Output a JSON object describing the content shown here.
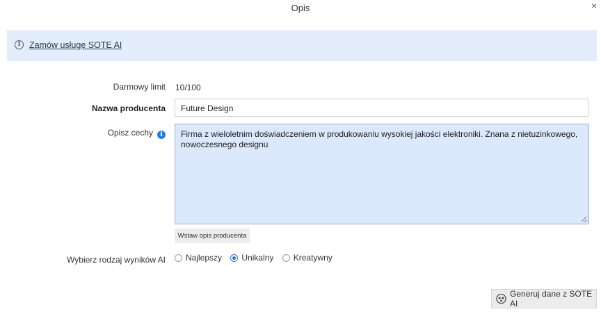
{
  "dialog": {
    "title": "Opis",
    "close_glyph": "×"
  },
  "banner": {
    "icon": "info-icon",
    "link_text": "Zamów usługę SOTE AI"
  },
  "form": {
    "free_limit_label": "Darmowy limit",
    "free_limit_value": "10/100",
    "producer_label": "Nazwa producenta",
    "producer_value": "Future Design",
    "describe_label": "Opisz cechy",
    "describe_value": "Firma z wieloletnim doświadczeniem w produkowaniu wysokiej jakości elektroniki. Znana z nietuzinkowego, nowoczesnego designu",
    "insert_button": "Wstaw opis producenta",
    "result_type_label": "Wybierz rodzaj wyników AI",
    "options": [
      "Najlepszy",
      "Unikalny",
      "Kreatywny"
    ],
    "selected_option": "Unikalny"
  },
  "footer": {
    "generate_button": "Generuj dane z SOTE AI",
    "generate_icon": "ai-sparkle-icon"
  },
  "colors": {
    "banner_bg": "#e4edfb",
    "textarea_bg": "#dce8fb",
    "accent": "#2f6fd0"
  }
}
